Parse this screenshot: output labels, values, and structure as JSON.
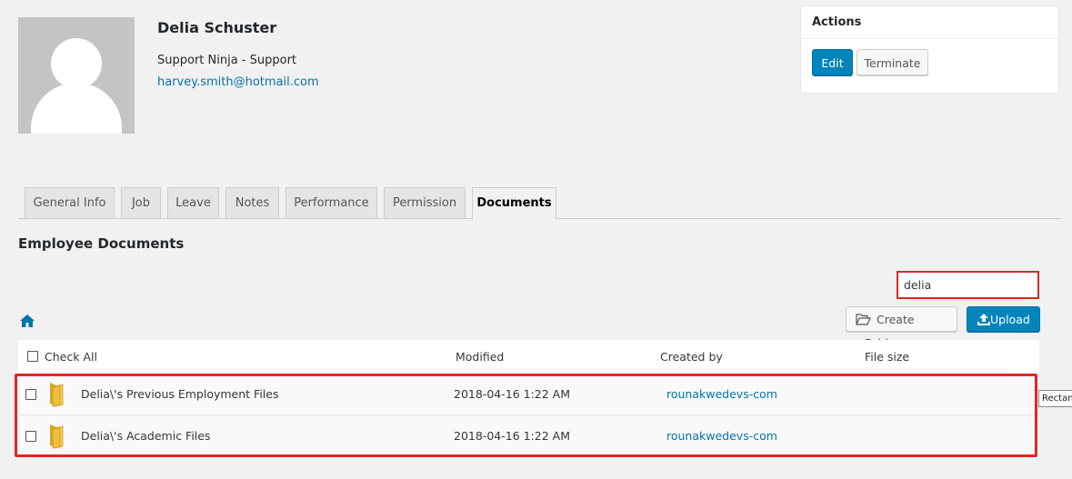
{
  "profile": {
    "name": "Delia Schuster",
    "role": "Support Ninja - Support",
    "email": "harvey.smith@hotmail.com"
  },
  "actions": {
    "title": "Actions",
    "edit_label": "Edit",
    "terminate_label": "Terminate"
  },
  "tabs": [
    {
      "label": "General Info"
    },
    {
      "label": "Job"
    },
    {
      "label": "Leave"
    },
    {
      "label": "Notes"
    },
    {
      "label": "Performance"
    },
    {
      "label": "Permission"
    },
    {
      "label": "Documents"
    }
  ],
  "documents": {
    "title": "Employee Documents",
    "search_value": "delia",
    "create_folder_label": "Create Folder",
    "upload_label": "Upload",
    "columns": {
      "check_all": "Check All",
      "modified": "Modified",
      "created_by": "Created by",
      "file_size": "File size"
    },
    "rows": [
      {
        "name": "Delia\\'s Previous Employment Files",
        "modified": "2018-04-16 1:22 AM",
        "created_by": "rounakwedevs-com",
        "size": ""
      },
      {
        "name": "Delia\\'s Academic Files",
        "modified": "2018-04-16 1:22 AM",
        "created_by": "rounakwedevs-com",
        "size": ""
      }
    ]
  },
  "tooltip": "Rectan",
  "colors": {
    "primary": "#0085ba",
    "link": "#0073aa",
    "highlight": "#e32525"
  }
}
